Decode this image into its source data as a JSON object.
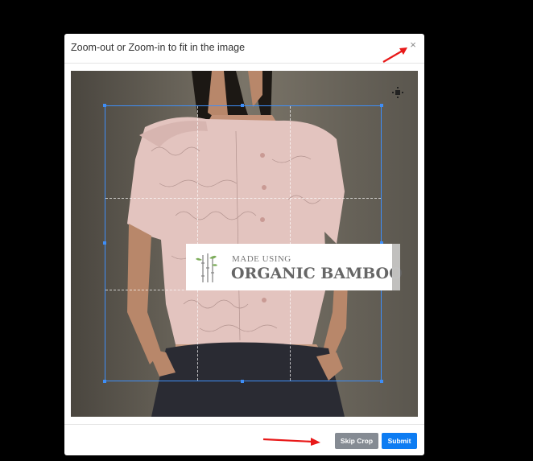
{
  "modal": {
    "title": "Zoom-out or Zoom-in to fit in the image",
    "close_label": "×"
  },
  "badge": {
    "line1": "MADE USING",
    "line2": "ORGANIC BAMBOO"
  },
  "footer": {
    "skip_label": "Skip Crop",
    "submit_label": "Submit"
  },
  "colors": {
    "crop_border": "#3e8ef7",
    "submit": "#0d7cf2",
    "skip": "#858b93",
    "annotation_arrow": "#e81919"
  },
  "icons": [
    "close-icon",
    "move-icon",
    "bamboo-logo-icon",
    "arrow-annotation"
  ]
}
